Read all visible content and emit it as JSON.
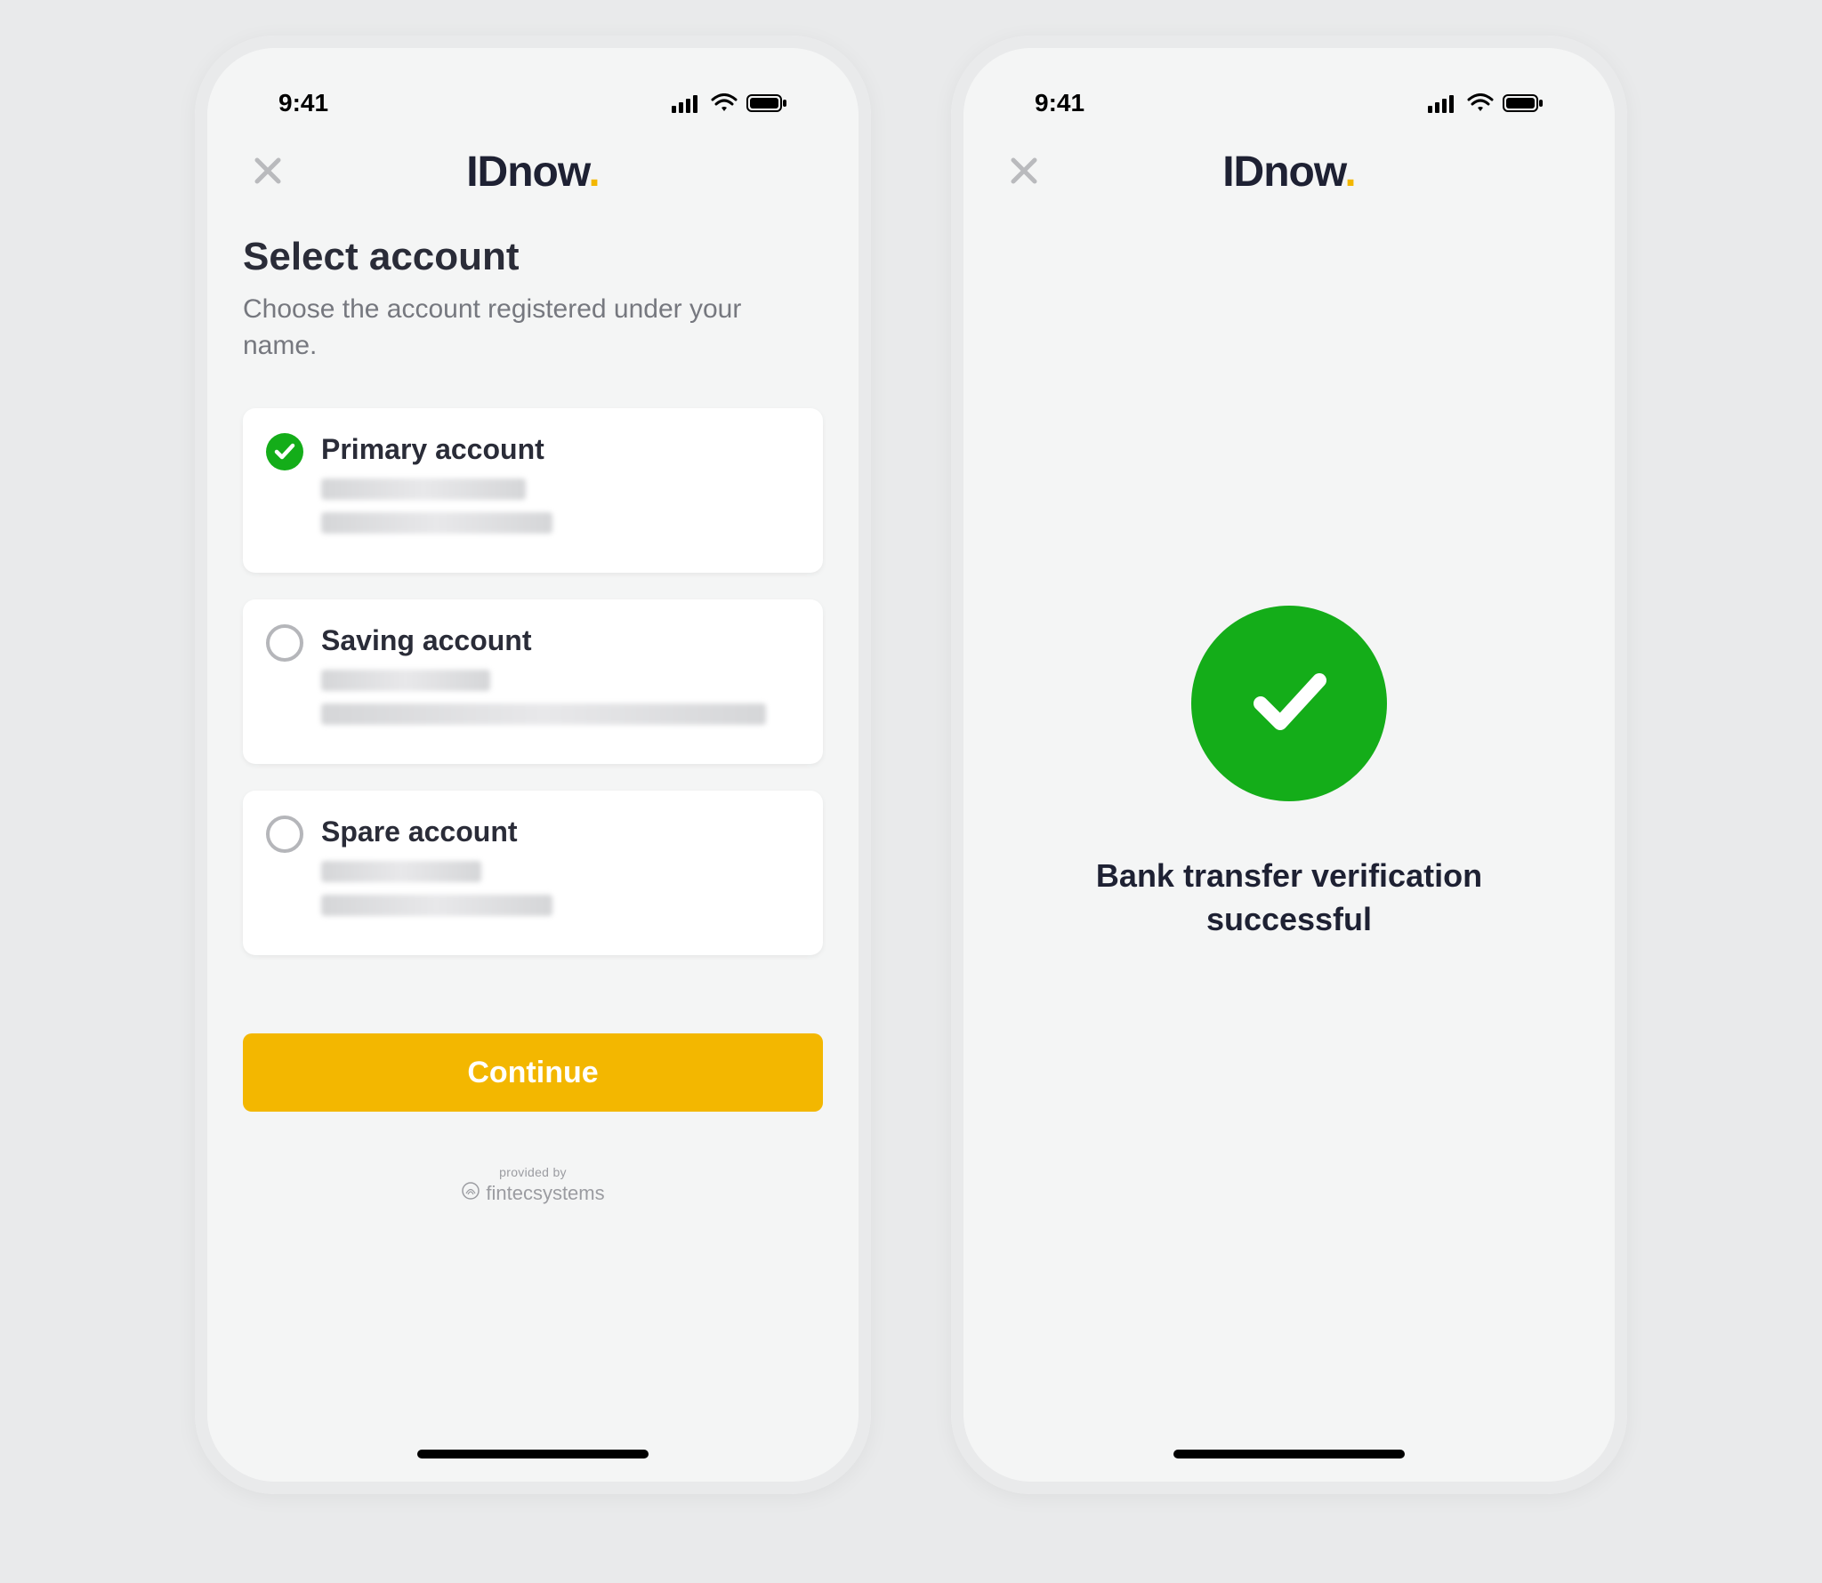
{
  "status": {
    "time": "9:41"
  },
  "brand": {
    "name": "IDnow",
    "dot": "."
  },
  "colors": {
    "accent": "#f3b700",
    "success": "#14ad19",
    "text": "#1e2133"
  },
  "screen1": {
    "title": "Select account",
    "subtitle": "Choose the account registered under your name.",
    "accounts": [
      {
        "label": "Primary account",
        "selected": true
      },
      {
        "label": "Saving account",
        "selected": false
      },
      {
        "label": "Spare account",
        "selected": false
      }
    ],
    "continue_label": "Continue",
    "provided_by_label": "provided by",
    "provider_name": "fintecsystems"
  },
  "screen2": {
    "message": "Bank transfer verification successful"
  }
}
